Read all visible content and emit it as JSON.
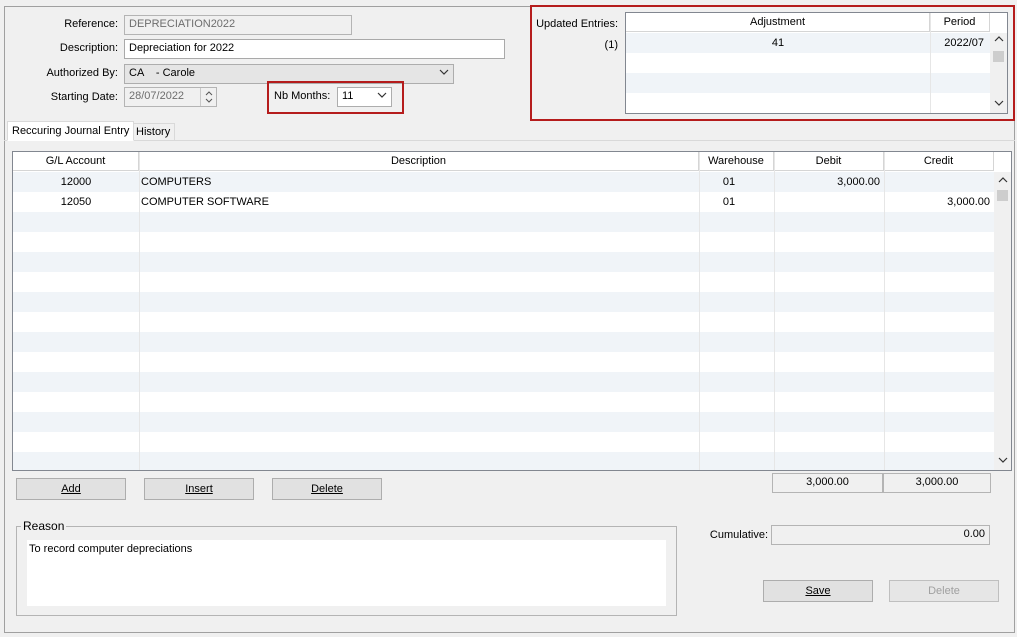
{
  "header": {
    "reference_label": "Reference:",
    "reference_value": "DEPRECIATION2022",
    "description_label": "Description:",
    "description_value": "Depreciation for 2022",
    "authorized_label": "Authorized By:",
    "authorized_value": "CA    - Carole",
    "starting_date_label": "Starting Date:",
    "starting_date_value": "28/07/2022",
    "nb_months_label": "Nb Months:",
    "nb_months_value": "11"
  },
  "updated_entries": {
    "label": "Updated Entries:",
    "count": "(1)",
    "columns": [
      "Adjustment",
      "Period"
    ],
    "rows": [
      {
        "adjustment": "41",
        "period": "2022/07"
      }
    ]
  },
  "tabs": [
    "Reccuring Journal Entry",
    "History"
  ],
  "journal": {
    "columns": [
      "G/L Account",
      "Description",
      "Warehouse",
      "Debit",
      "Credit"
    ],
    "rows": [
      {
        "account": "12000",
        "description": "COMPUTERS",
        "warehouse": "01",
        "debit": "3,000.00",
        "credit": ""
      },
      {
        "account": "12050",
        "description": "COMPUTER SOFTWARE",
        "warehouse": "01",
        "debit": "",
        "credit": "3,000.00"
      }
    ],
    "total_debit": "3,000.00",
    "total_credit": "3,000.00"
  },
  "buttons": {
    "add": "Add",
    "insert": "Insert",
    "delete": "Delete",
    "save": "Save",
    "delete_bottom": "Delete"
  },
  "reason": {
    "label": "Reason",
    "text": "To record computer depreciations"
  },
  "cumulative": {
    "label": "Cumulative:",
    "value": "0.00"
  }
}
